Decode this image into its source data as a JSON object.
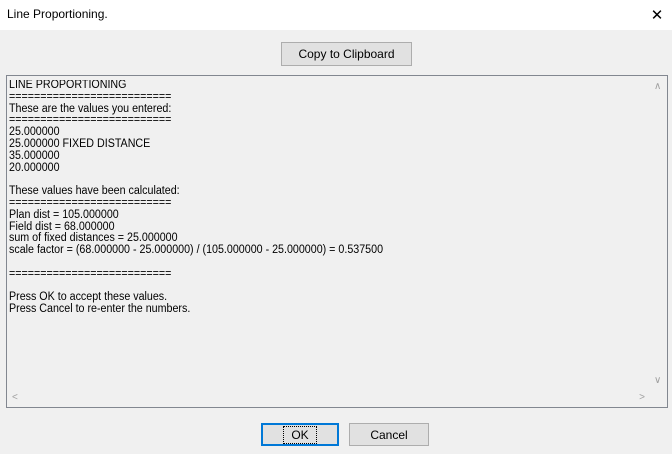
{
  "window": {
    "title": "Line Proportioning.",
    "close_glyph": "✕"
  },
  "toolbar": {
    "copy_label": "Copy to Clipboard"
  },
  "report": {
    "text": "LINE PROPORTIONING\n==========================\nThese are the values you entered:\n==========================\n25.000000\n25.000000 FIXED DISTANCE\n35.000000\n20.000000\n\nThese values have been calculated:\n==========================\nPlan dist = 105.000000\nField dist = 68.000000\nsum of fixed distances = 25.000000\nscale factor = (68.000000 - 25.000000) / (105.000000 - 25.000000) = 0.537500\n\n==========================\n\nPress OK to accept these values.\nPress Cancel to re-enter the numbers."
  },
  "scrollbar": {
    "up": "∧",
    "down": "∨",
    "left": "<",
    "right": ">"
  },
  "footer": {
    "ok_label": "OK",
    "cancel_label": "Cancel"
  }
}
